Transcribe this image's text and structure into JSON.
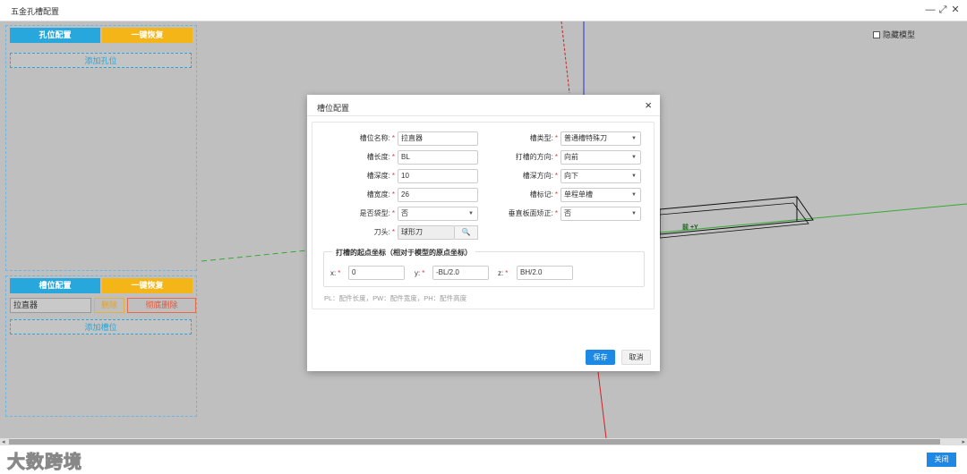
{
  "window": {
    "title": "五金孔槽配置",
    "minimize": "—",
    "maximize": "⤢",
    "close": "✕"
  },
  "hole_panel": {
    "tab_label": "孔位配置",
    "restore_label": "一键恢复",
    "add_label": "添加孔位"
  },
  "slot_panel": {
    "tab_label": "槽位配置",
    "restore_label": "一键恢复",
    "item_name": "拉直器",
    "delete_label": "删除",
    "delete_all_label": "彻底删除",
    "add_label": "添加槽位"
  },
  "viewport": {
    "hide_model_label": "隐藏模型",
    "axis_label": "前 +Y"
  },
  "modal": {
    "title": "槽位配置",
    "close_icon": "×",
    "fields": {
      "slot_name_label": "槽位名称:",
      "slot_name_value": "拉直器",
      "slot_type_label": "槽类型:",
      "slot_type_value": "普通槽特殊刀",
      "slot_length_label": "槽长度:",
      "slot_length_value": "BL",
      "cut_direction_label": "打槽的方向:",
      "cut_direction_value": "向前",
      "slot_depth_label": "槽深度:",
      "slot_depth_value": "10",
      "depth_direction_label": "槽深方向:",
      "depth_direction_value": "向下",
      "slot_width_label": "槽宽度:",
      "slot_width_value": "26",
      "slot_mark_label": "槽标记:",
      "slot_mark_value": "单程单槽",
      "is_bag_label": "是否袋型:",
      "is_bag_value": "否",
      "vertical_correct_label": "垂直板面矫正:",
      "vertical_correct_value": "否",
      "cutter_label": "刀头:",
      "cutter_value": "球形刀"
    },
    "origin": {
      "legend": "打槽的起点坐标（相对于模型的原点坐标）",
      "x_label": "x:",
      "x_value": "0",
      "y_label": "y:",
      "y_value": "-BL/2.0",
      "z_label": "z:",
      "z_value": "BH/2.0"
    },
    "note": "PL：配件长度，PW：配件宽度，PH：配件高度",
    "save_label": "保存",
    "cancel_label": "取消"
  },
  "footer": {
    "close_label": "关闭",
    "watermark": "大数跨境"
  }
}
